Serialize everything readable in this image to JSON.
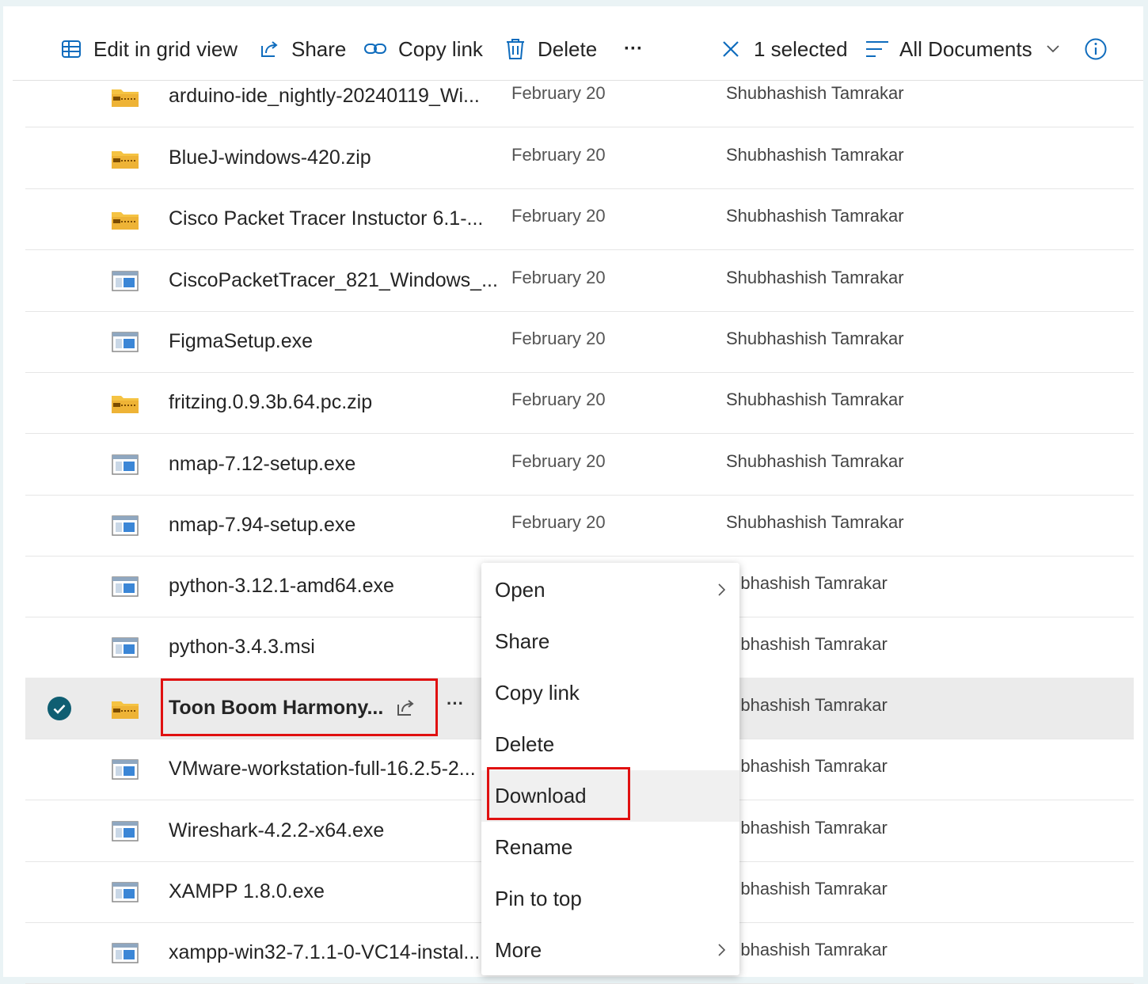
{
  "toolbar": {
    "edit_grid": "Edit in grid view",
    "share": "Share",
    "copy_link": "Copy link",
    "delete": "Delete",
    "more": "···",
    "selected": "1 selected",
    "view": "All Documents"
  },
  "files": [
    {
      "name": "arduino-ide_nightly-20240119_Wi...",
      "date": "February 20",
      "owner": "Shubhashish Tamrakar",
      "icon": "zip-folder-icon"
    },
    {
      "name": "BlueJ-windows-420.zip",
      "date": "February 20",
      "owner": "Shubhashish Tamrakar",
      "icon": "zip-folder-icon"
    },
    {
      "name": "Cisco Packet Tracer Instuctor 6.1-...",
      "date": "February 20",
      "owner": "Shubhashish Tamrakar",
      "icon": "zip-folder-icon"
    },
    {
      "name": "CiscoPacketTracer_821_Windows_...",
      "date": "February 20",
      "owner": "Shubhashish Tamrakar",
      "icon": "exe-file-icon"
    },
    {
      "name": "FigmaSetup.exe",
      "date": "February 20",
      "owner": "Shubhashish Tamrakar",
      "icon": "exe-file-icon"
    },
    {
      "name": "fritzing.0.9.3b.64.pc.zip",
      "date": "February 20",
      "owner": "Shubhashish Tamrakar",
      "icon": "zip-folder-icon"
    },
    {
      "name": "nmap-7.12-setup.exe",
      "date": "February 20",
      "owner": "Shubhashish Tamrakar",
      "icon": "exe-file-icon"
    },
    {
      "name": "nmap-7.94-setup.exe",
      "date": "February 20",
      "owner": "Shubhashish Tamrakar",
      "icon": "exe-file-icon"
    },
    {
      "name": "python-3.12.1-amd64.exe",
      "date": "",
      "owner": "ıubhashish Tamrakar",
      "icon": "exe-file-icon"
    },
    {
      "name": "python-3.4.3.msi",
      "date": "",
      "owner": "ıubhashish Tamrakar",
      "icon": "exe-file-icon"
    },
    {
      "name": "Toon Boom Harmony...",
      "date": "",
      "owner": "ıubhashish Tamrakar",
      "icon": "zip-folder-icon",
      "selected": true,
      "more": "···"
    },
    {
      "name": "VMware-workstation-full-16.2.5-2...",
      "date": "",
      "owner": "ıubhashish Tamrakar",
      "icon": "exe-file-icon"
    },
    {
      "name": "Wireshark-4.2.2-x64.exe",
      "date": "",
      "owner": "ıubhashish Tamrakar",
      "icon": "exe-file-icon"
    },
    {
      "name": "XAMPP 1.8.0.exe",
      "date": "",
      "owner": "ıubhashish Tamrakar",
      "icon": "exe-file-icon"
    },
    {
      "name": "xampp-win32-7.1.1-0-VC14-instal...",
      "date": "",
      "owner": "ıubhashish Tamrakar",
      "icon": "exe-file-icon"
    }
  ],
  "context_menu": {
    "items": [
      {
        "label": "Open",
        "submenu": true
      },
      {
        "label": "Share",
        "submenu": false
      },
      {
        "label": "Copy link",
        "submenu": false
      },
      {
        "label": "Delete",
        "submenu": false
      },
      {
        "label": "Download",
        "submenu": false,
        "highlighted": true
      },
      {
        "label": "Rename",
        "submenu": false
      },
      {
        "label": "Pin to top",
        "submenu": false
      },
      {
        "label": "More",
        "submenu": true
      }
    ]
  },
  "colors": {
    "accent": "#0f6cbd",
    "check": "#0f5e72",
    "highlight_box": "#e01010",
    "zip_yellow": "#f5c343"
  }
}
